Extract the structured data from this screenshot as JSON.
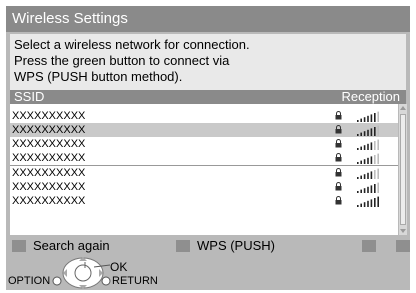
{
  "title": "Wireless Settings",
  "instructions": [
    "Select a wireless network for connection.",
    "Press the green button to connect via",
    "WPS (PUSH button method)."
  ],
  "columns": {
    "ssid": "SSID",
    "reception": "Reception"
  },
  "networks": [
    {
      "ssid": "XXXXXXXXXX",
      "locked": true,
      "signal_bars": 4,
      "selected": false
    },
    {
      "ssid": "XXXXXXXXXX",
      "locked": true,
      "signal_bars": 4,
      "selected": true
    },
    {
      "ssid": "XXXXXXXXXX",
      "locked": true,
      "signal_bars": 3,
      "selected": false
    },
    {
      "ssid": "XXXXXXXXXX",
      "locked": true,
      "signal_bars": 3,
      "selected": false
    },
    {
      "ssid": "XXXXXXXXXX",
      "locked": true,
      "signal_bars": 3,
      "selected": false
    },
    {
      "ssid": "XXXXXXXXXX",
      "locked": true,
      "signal_bars": 4,
      "selected": false
    },
    {
      "ssid": "XXXXXXXXXX",
      "locked": true,
      "signal_bars": 5,
      "selected": false
    }
  ],
  "buttons": {
    "search_again": "Search again",
    "wps_push": "WPS (PUSH)"
  },
  "nav": {
    "ok": "OK",
    "option": "OPTION",
    "return": "RETURN"
  },
  "colors": {
    "title_bar": "#8a8a8a",
    "panel": "#b9b9b9",
    "selected_row": "#c9c9c9",
    "color_button": "#8f8f8f"
  }
}
